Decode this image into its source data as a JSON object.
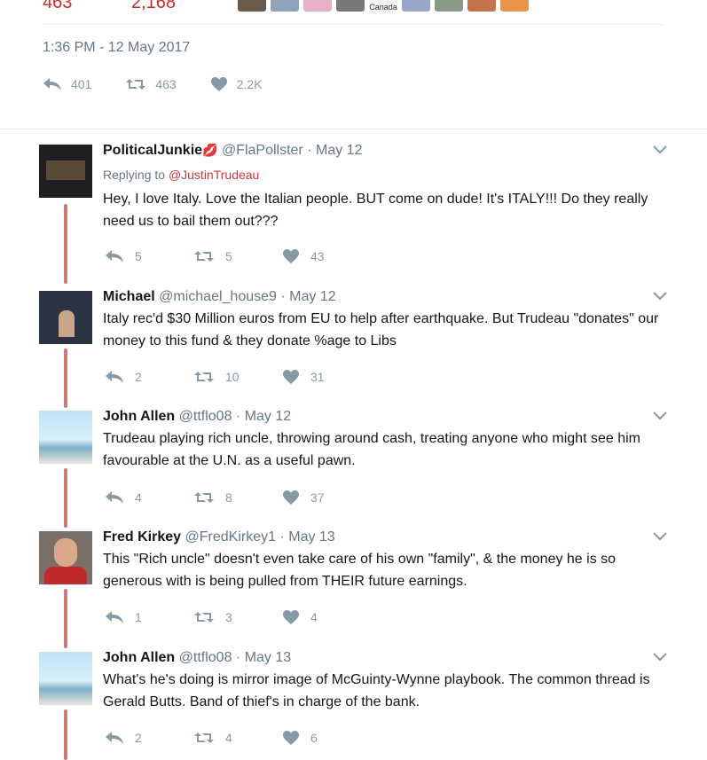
{
  "header": {
    "stats": [
      "463",
      "2,168"
    ],
    "mini_avatar_caption": "Canada",
    "timestamp": "1:36 PM - 12 May 2017",
    "actions": {
      "replies": "401",
      "retweets": "463",
      "likes": "2.2K"
    }
  },
  "colors": {
    "accent_red": "#c63a3a",
    "thread_line": "#c97b7b",
    "muted": "#657786",
    "icon_gray": "#8899a6"
  },
  "tweets": [
    {
      "name": "PoliticalJunkie",
      "name_emoji": "💋",
      "handle": "@FlaPollster",
      "dot": "·",
      "date": "May 12",
      "replying_prefix": "Replying to ",
      "replying_to": "@JustinTrudeau",
      "text": "Hey, I love Italy. Love the Italian people. BUT come on dude! It's ITALY!!! Do they really need us to bail them out???",
      "replies": "5",
      "retweets": "5",
      "likes": "43"
    },
    {
      "name": "Michael",
      "handle": "@michael_house9",
      "dot": "·",
      "date": "May 12",
      "text": "Italy rec'd $30 Million euros from EU to help after earthquake.  But Trudeau \"donates\" our money to this fund & they donate %age to Libs",
      "replies": "2",
      "retweets": "10",
      "likes": "31"
    },
    {
      "name": "John Allen",
      "handle": "@ttflo08",
      "dot": "·",
      "date": "May 12",
      "text": "Trudeau playing rich uncle, throwing around cash, treating anyone who might see him favourable at the U.N. as a useful pawn.",
      "replies": "4",
      "retweets": "8",
      "likes": "37"
    },
    {
      "name": "Fred Kirkey",
      "handle": "@FredKirkey1",
      "dot": "·",
      "date": "May 13",
      "text": "This \"Rich uncle\" doesn't even take care of his own \"family\", & the money he is so generous with is being pulled from THEIR future earnings.",
      "replies": "1",
      "retweets": "3",
      "likes": "4"
    },
    {
      "name": "John Allen",
      "handle": "@ttflo08",
      "dot": "·",
      "date": "May 13",
      "text": "What's he's doing is mirror image of McGuinty-Wynne playbook. The common thread is Gerald Butts. Band of thief's in charge of the bank.",
      "replies": "2",
      "retweets": "4",
      "likes": "6"
    }
  ]
}
